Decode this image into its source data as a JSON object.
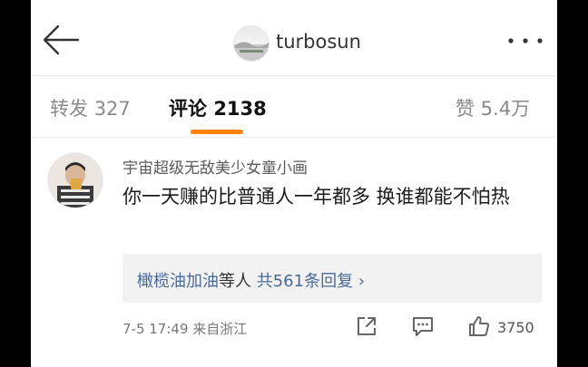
{
  "header": {
    "username": "turbosun",
    "back_icon": "back-arrow-icon",
    "more_icon": "more-dots-icon"
  },
  "tabs": [
    {
      "label": "转发",
      "count": "327"
    },
    {
      "label": "评论",
      "count": "2138",
      "active": true
    },
    {
      "label": "赞",
      "count": "5.4万"
    }
  ],
  "accent_color": "#ff8200",
  "link_color": "#4a6a96",
  "comment": {
    "author": "宇宙超级无敌美少女童小画",
    "text": "你一天赚的比普通人一年都多  换谁都能不怕热",
    "replies": {
      "users": "橄榄油加油",
      "suffix": "等人",
      "summary": "共561条回复",
      "chevron": "›"
    },
    "time": "7-5 17:49",
    "location": "来自浙江",
    "likes": "3750"
  }
}
